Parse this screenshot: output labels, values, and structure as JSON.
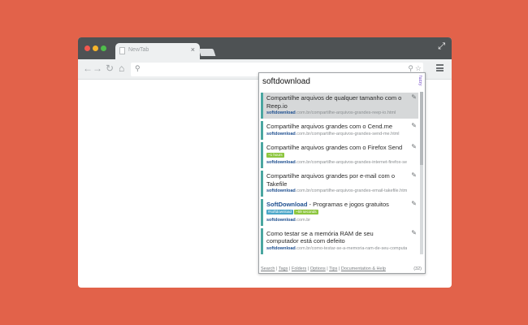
{
  "browser": {
    "tab_title": "NewTab",
    "tab_close": "×"
  },
  "popup": {
    "query": "softdownload",
    "side_label": "fuzzy",
    "results": [
      {
        "title": "Compartilhe arquivos de qualquer tamanho com o Reep.io",
        "title_prefix": "",
        "host": "softdownload",
        "path": ".com.br/compartilhe-arquivos-grandes-reep-io.html",
        "tags": [],
        "selected": true
      },
      {
        "title": "Compartilhe arquivos grandes com o Cend.me",
        "title_prefix": "",
        "host": "softdownload",
        "path": ".com.br/compartilhe-arquivos-grandes-send-me.html",
        "tags": [],
        "selected": false
      },
      {
        "title": "Compartilhe arquivos grandes com o Firefox Send",
        "title_prefix": "",
        "host": "softdownload",
        "path": ".com.br/compartilhe-arquivos-grandes-internet-firefox-send.html",
        "tags": [
          {
            "label": "~1 hours",
            "color": "#8dc63f"
          }
        ],
        "selected": false
      },
      {
        "title": "Compartilhe arquivos grandes por e-mail com o Takefile",
        "title_prefix": "",
        "host": "softdownload",
        "path": ".com.br/compartilhe-arquivos-grandes-email-takefile.html",
        "tags": [],
        "selected": false
      },
      {
        "title": " - Programas e jogos gratuitos",
        "title_prefix": "SoftDownload",
        "host": "softdownload",
        "path": ".com.br",
        "tags": [
          {
            "label": "#softdownload",
            "color": "#4aa6c8"
          },
          {
            "label": "~59 seconds",
            "color": "#8dc63f"
          }
        ],
        "selected": false
      },
      {
        "title": "Como testar se a memória RAM de seu computador está com defeito",
        "title_prefix": "",
        "host": "softdownload",
        "path": ".com.br/como-testar-se-a-memoria-ram-de-seu-computador-esta-...",
        "tags": [],
        "selected": false
      }
    ],
    "footer": {
      "links": [
        "Search",
        "Tags",
        "Folders",
        "Options",
        "Tips",
        "Documentation & Help"
      ],
      "count": "(32)"
    }
  },
  "colors": {
    "background": "#e2624a",
    "titlebar": "#4e5254",
    "accent_bar": "#4aa6a0",
    "link_host": "#1e4f8f"
  }
}
